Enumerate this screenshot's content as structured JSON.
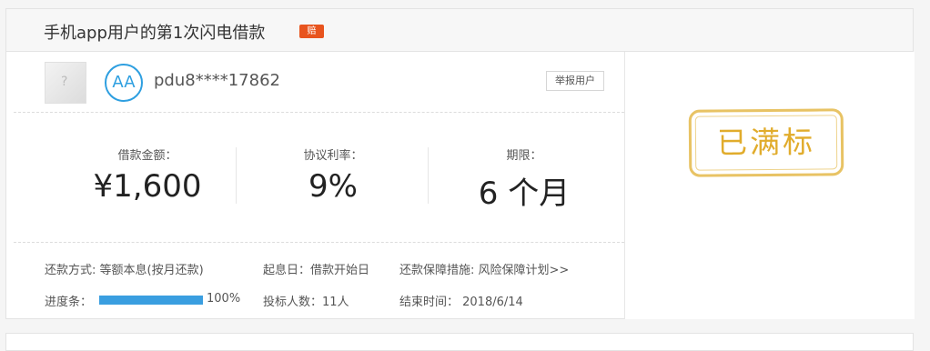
{
  "loan": {
    "title": "手机app用户的第1次闪电借款",
    "tag": "赔"
  },
  "user": {
    "badge": "AA",
    "name": "pdu8****17862",
    "report_label": "举报用户"
  },
  "stats": [
    {
      "label": "借款金额：",
      "value": "¥1,600"
    },
    {
      "label": "协议利率：",
      "value": "9%"
    },
    {
      "label": "期限：",
      "value": "6 个月"
    }
  ],
  "details": {
    "repay_method": "还款方式: 等额本息(按月还款)",
    "interest_start": "起息日：借款开始日",
    "guarantee": "还款保障措施: 风险保障计划>>",
    "progress_label": "进度条：",
    "progress_value": 1.0,
    "progress_text": "100%",
    "bidders": "投标人数：11人",
    "end_time": "结束时间： 2018/6/14"
  },
  "status": {
    "stamp": "已满标",
    "color": "#e1ac2c"
  },
  "colors": {
    "accent": "#2e9fe0",
    "tag_bg": "#e8541e",
    "progress": "#3a9ee0"
  }
}
